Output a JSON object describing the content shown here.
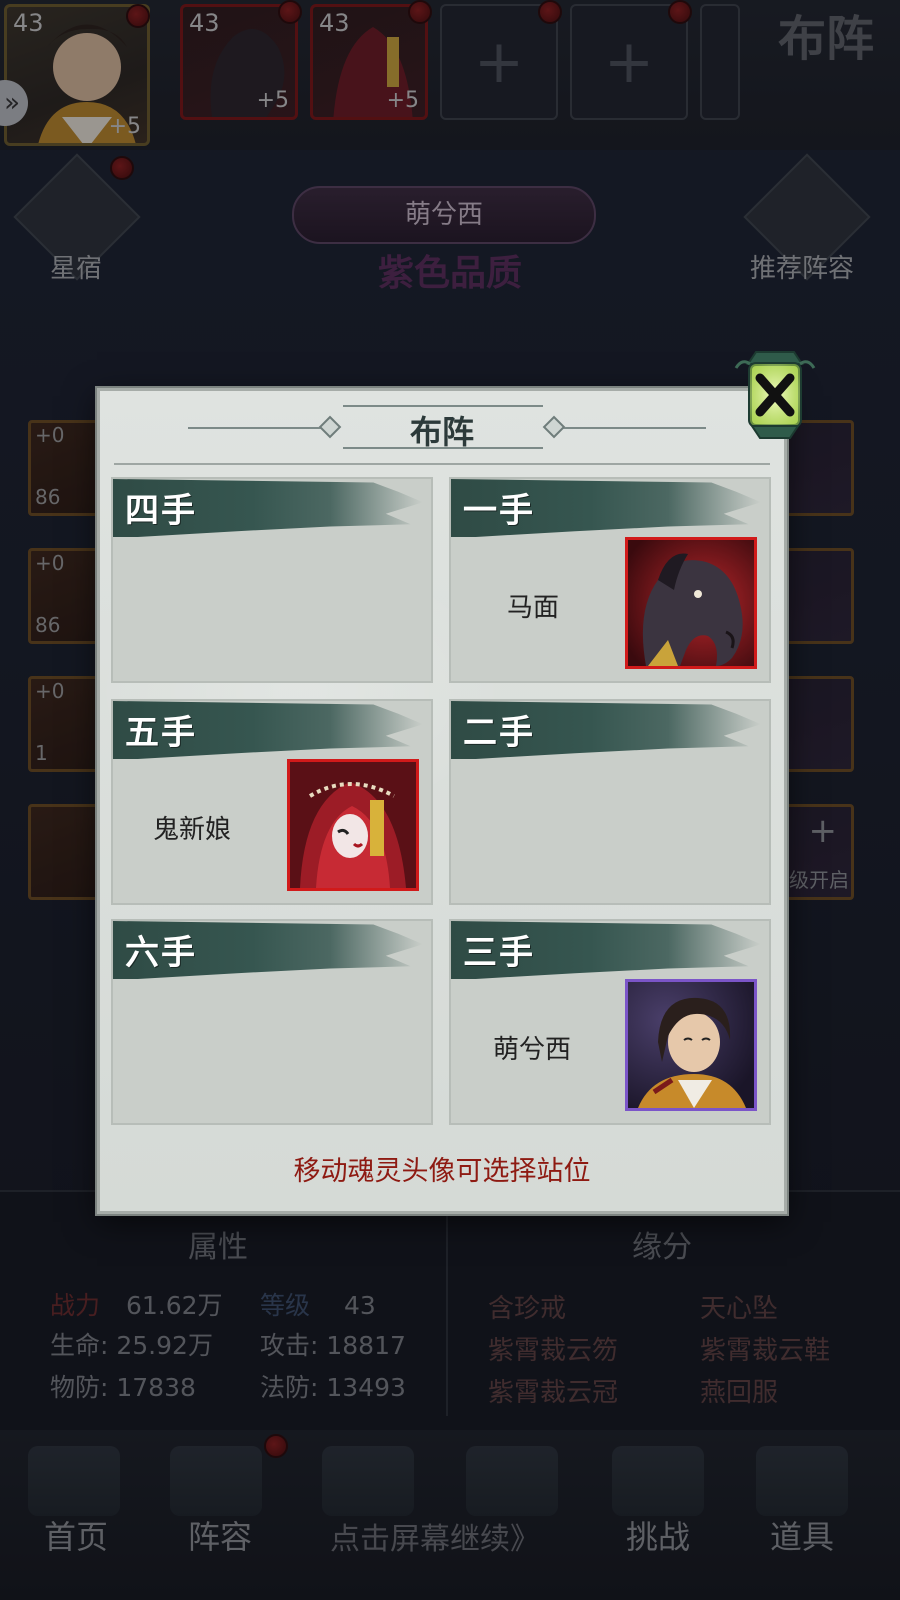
{
  "top_slots": {
    "main": {
      "level": "43",
      "bonus": "+5"
    },
    "slot2": {
      "level": "43",
      "bonus": "+5"
    },
    "slot3": {
      "level": "43",
      "bonus": "+5"
    }
  },
  "top_right_label": "布阵",
  "side_left_label": "星宿",
  "side_right_label": "推荐阵容",
  "hero_banner_name": "萌兮西",
  "quality_label": "紫色品质",
  "equipment": {
    "e1": {
      "plus": "+0",
      "level": "86"
    },
    "e2": {
      "plus": "+0",
      "level": "86"
    },
    "e3": {
      "plus": "+0",
      "level": "1"
    }
  },
  "right_locked_label": "级开启",
  "attributes": {
    "title": "属性",
    "power_key": "战力",
    "power_val": "61.62万",
    "level_key": "等级",
    "level_val": "43",
    "hp": "生命:  25.92万",
    "atk": "攻击:  18817",
    "pdef": "物防:  17838",
    "mdef": "法防:  13493"
  },
  "fate": {
    "title": "缘分",
    "items": [
      "含珍戒",
      "天心坠",
      "紫霄裁云笏",
      "紫霄裁云鞋",
      "紫霄裁云冠",
      "燕回服"
    ]
  },
  "nav": {
    "home": "首页",
    "lineup": "阵容",
    "challenge": "挑战",
    "items": "道具",
    "overlay_text": "点击屏幕继续》"
  },
  "dialog": {
    "title": "布阵",
    "cells": [
      {
        "label": "四手",
        "hero": ""
      },
      {
        "label": "一手",
        "hero": "马面"
      },
      {
        "label": "五手",
        "hero": "鬼新娘"
      },
      {
        "label": "二手",
        "hero": ""
      },
      {
        "label": "六手",
        "hero": ""
      },
      {
        "label": "三手",
        "hero": "萌兮西"
      }
    ],
    "hint": "移动魂灵头像可选择站位"
  }
}
